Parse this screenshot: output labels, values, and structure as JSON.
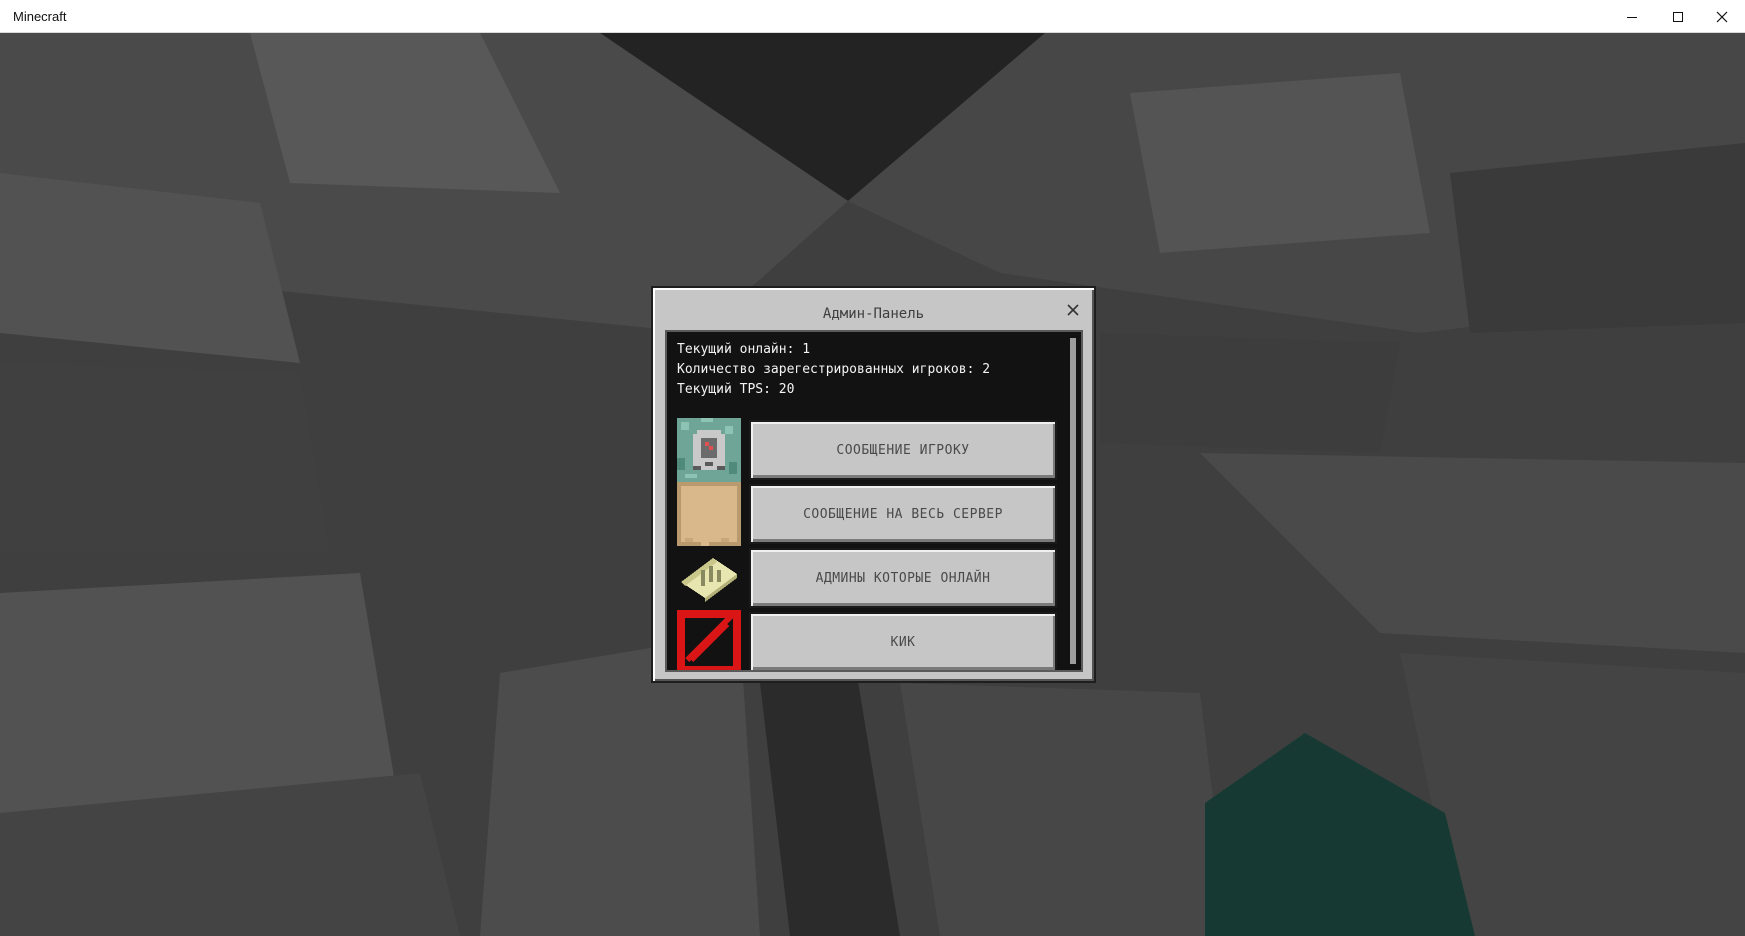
{
  "window": {
    "title": "Minecraft",
    "controls": [
      "minimize",
      "maximize",
      "close"
    ]
  },
  "dialog": {
    "title": "Админ-Панель",
    "info": [
      "Текущий онлайн: 1",
      "Количество зарегестрированных игроков: 2",
      "Текущий TPS: 20"
    ],
    "buttons": [
      {
        "label": "СООБЩЕНИЕ ИГРОКУ",
        "icon": "command-block-icon"
      },
      {
        "label": "СООБЩЕНИЕ НА ВЕСЬ СЕРВЕР",
        "icon": "map-paper-icon"
      },
      {
        "label": "АДМИНЫ КОТОРЫЕ ОНЛАЙН",
        "icon": "paper-scroll-icon"
      },
      {
        "label": "КИК",
        "icon": "barrier-icon"
      }
    ]
  },
  "colors": {
    "panel_bg": "#c6c6c6",
    "list_bg": "#121212",
    "button_text": "#4a4a4a",
    "info_text": "#f4f4f4"
  }
}
